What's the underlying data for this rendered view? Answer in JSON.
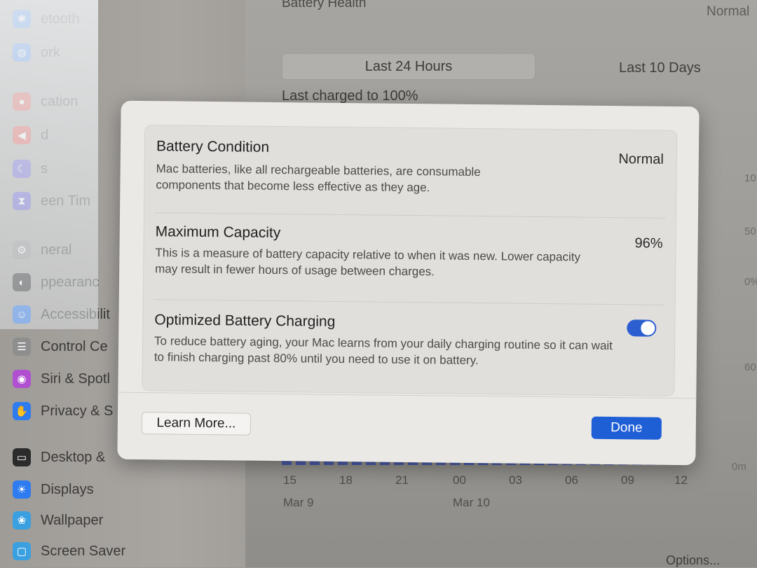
{
  "sidebar": {
    "items": [
      {
        "label": "etooth",
        "icon": "bluetooth-icon",
        "color": "#2f7bf0"
      },
      {
        "label": "ork",
        "icon": "network-icon",
        "color": "#2f7bf0"
      },
      {
        "label": "cation",
        "icon": "notifications-icon",
        "color": "#e2423a"
      },
      {
        "label": "d",
        "icon": "sound-icon",
        "color": "#e2423a"
      },
      {
        "label": "s",
        "icon": "focus-icon",
        "color": "#5a4fd0"
      },
      {
        "label": "een Tim",
        "icon": "screen-time-icon",
        "color": "#5a4fd0"
      },
      {
        "label": "neral",
        "icon": "general-icon",
        "color": "#8e8e8e"
      },
      {
        "label": "ppearanc",
        "icon": "appearance-icon",
        "color": "#2b2b2b"
      },
      {
        "label": "Accessibilit",
        "icon": "accessibility-icon",
        "color": "#2f7bf0"
      },
      {
        "label": "Control Ce",
        "icon": "control-center-icon",
        "color": "#8e8e8e"
      },
      {
        "label": "Siri & Spotl",
        "icon": "siri-icon",
        "color": "#b04fd0"
      },
      {
        "label": "Privacy & S",
        "icon": "privacy-hand-icon",
        "color": "#2f7bf0"
      },
      {
        "label": "Desktop &",
        "icon": "desktop-dock-icon",
        "color": "#2b2b2b"
      },
      {
        "label": "Displays",
        "icon": "displays-icon",
        "color": "#2f7bf0"
      },
      {
        "label": "Wallpaper",
        "icon": "wallpaper-icon",
        "color": "#3aa0e0"
      },
      {
        "label": "Screen Saver",
        "icon": "screen-saver-icon",
        "color": "#3aa0e0"
      }
    ]
  },
  "background": {
    "section_title": "Battery Health",
    "status_right": "Normal",
    "segment_active": "Last 24 Hours",
    "segment_inactive": "Last 10 Days",
    "last_charged": "Last charged to 100%",
    "right_axis_labels": [
      "10",
      "50",
      "0%",
      "60",
      "0m"
    ],
    "time_ticks": [
      "15",
      "18",
      "21",
      "00",
      "03",
      "06",
      "09",
      "12"
    ],
    "dates": [
      "Mar 9",
      "Mar 10"
    ],
    "options_label": "Options..."
  },
  "modal": {
    "rows": [
      {
        "title": "Battery Condition",
        "description": "Mac batteries, like all rechargeable batteries, are consumable components that become less effective as they age.",
        "value": "Normal"
      },
      {
        "title": "Maximum Capacity",
        "description": "This is a measure of battery capacity relative to when it was new. Lower capacity may result in fewer hours of usage between charges.",
        "value": "96%"
      },
      {
        "title": "Optimized Battery Charging",
        "description": "To reduce battery aging, your Mac learns from your daily charging routine so it can wait to finish charging past 80% until you need to use it on battery.",
        "toggle_on": true
      }
    ],
    "learn_more_label": "Learn More...",
    "done_label": "Done"
  },
  "colors": {
    "accent": "#1f5fd6",
    "toggle_on": "#2d5fd0"
  }
}
